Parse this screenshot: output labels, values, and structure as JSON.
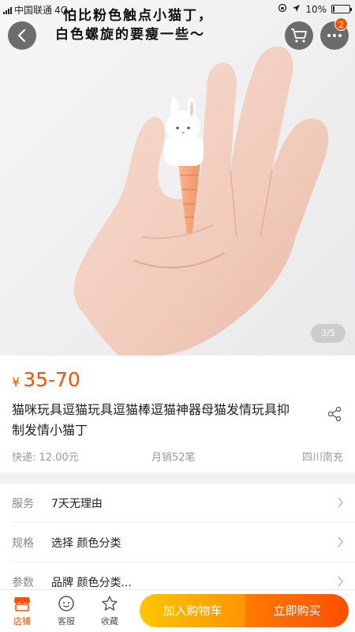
{
  "status_bar": {
    "carrier": "中国联通",
    "network": "4G",
    "battery": "10%",
    "battery_level": 0.1
  },
  "photo": {
    "caption_line1": "怕比粉色触点小猫丁，",
    "caption_line2": "白色螺旋的要瘦一些～",
    "pager": "3/5",
    "cart_badge": "2"
  },
  "product": {
    "currency": "¥",
    "price": "35-70",
    "title": "猫咪玩具逗猫玩具逗猫棒逗猫神器母猫发情玩具抑制发情小猫丁",
    "shipping": "快递: 12.00元",
    "sales": "月销52笔",
    "location": "四川南充"
  },
  "options": [
    {
      "label": "服务",
      "value": "7天无理由"
    },
    {
      "label": "规格",
      "value": "选择  颜色分类"
    },
    {
      "label": "参数",
      "value": "品牌 颜色分类..."
    }
  ],
  "bottom_bar": {
    "shop": "店铺",
    "service": "客服",
    "favorite": "收藏",
    "add_to_cart": "加入购物车",
    "buy_now": "立即购买"
  },
  "colors": {
    "accent": "#ff5000",
    "cart_button": "#ffa800",
    "buy_button": "#ff5000"
  }
}
